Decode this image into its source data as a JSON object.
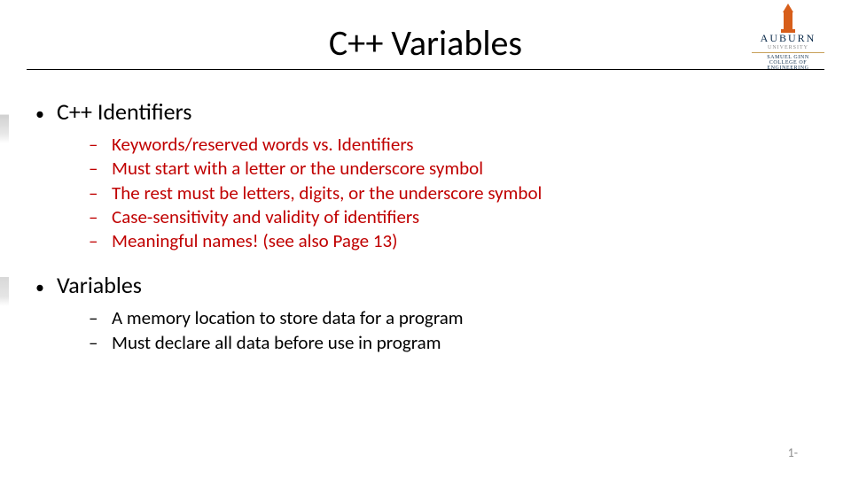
{
  "title": "C++ Variables",
  "logo": {
    "name": "AUBURN",
    "sub": "UNIVERSITY",
    "college_line1": "SAMUEL GINN",
    "college_line2": "COLLEGE OF ENGINEERING"
  },
  "sections": [
    {
      "heading": "C++ Identifiers",
      "color": "red",
      "items": [
        "Keywords/reserved words vs. Identifiers",
        "Must start with a letter or the underscore symbol",
        "The rest must be letters, digits, or the underscore symbol",
        "Case-sensitivity and validity of identifiers",
        "Meaningful names! (see also Page 13)"
      ]
    },
    {
      "heading": "Variables",
      "color": "black",
      "items": [
        "A memory location to store data for a program",
        "Must declare all data before use in program"
      ]
    }
  ],
  "page": "1-"
}
